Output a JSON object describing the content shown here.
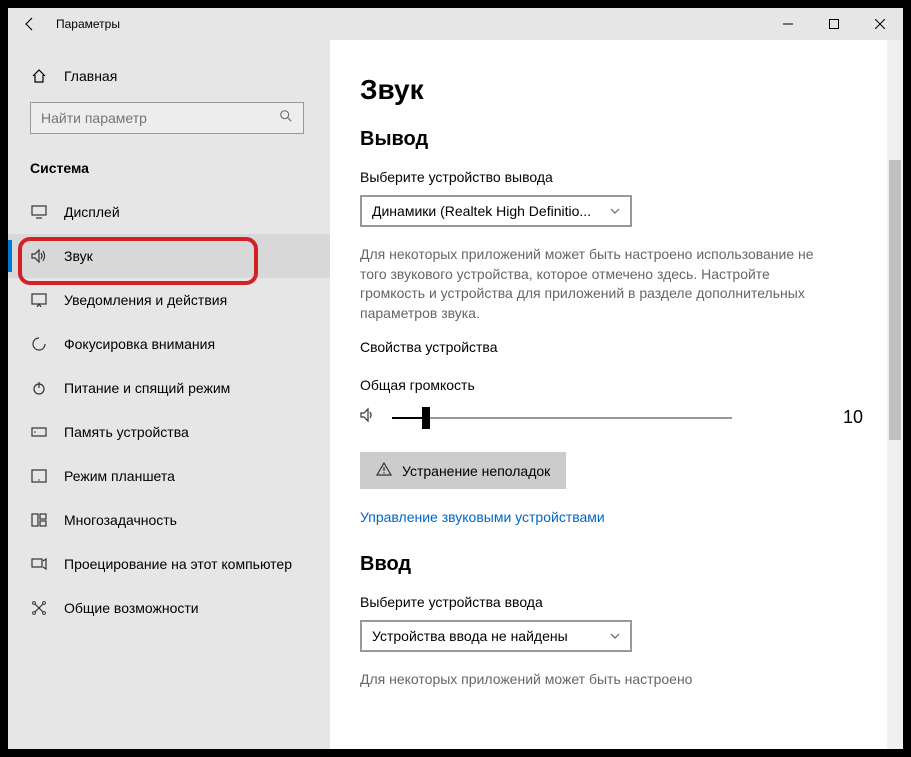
{
  "titlebar": {
    "title": "Параметры"
  },
  "sidebar": {
    "home": "Главная",
    "search_placeholder": "Найти параметр",
    "section": "Система",
    "items": [
      {
        "label": "Дисплей"
      },
      {
        "label": "Звук"
      },
      {
        "label": "Уведомления и действия"
      },
      {
        "label": "Фокусировка внимания"
      },
      {
        "label": "Питание и спящий режим"
      },
      {
        "label": "Память устройства"
      },
      {
        "label": "Режим планшета"
      },
      {
        "label": "Многозадачность"
      },
      {
        "label": "Проецирование на этот компьютер"
      },
      {
        "label": "Общие возможности"
      }
    ]
  },
  "content": {
    "title": "Звук",
    "output": {
      "heading": "Вывод",
      "device_label": "Выберите устройство вывода",
      "device_value": "Динамики (Realtek High Definitio...",
      "desc": "Для некоторых приложений может быть настроено использование не того звукового устройства, которое отмечено здесь. Настройте громкость и устройства для приложений в разделе дополнительных параметров звука.",
      "props": "Свойства устройства",
      "volume_label": "Общая громкость",
      "volume_value": "10",
      "troubleshoot": "Устранение неполадок",
      "manage": "Управление звуковыми устройствами"
    },
    "input": {
      "heading": "Ввод",
      "device_label": "Выберите устройства ввода",
      "device_value": "Устройства ввода не найдены",
      "desc": "Для некоторых приложений может быть настроено"
    }
  }
}
